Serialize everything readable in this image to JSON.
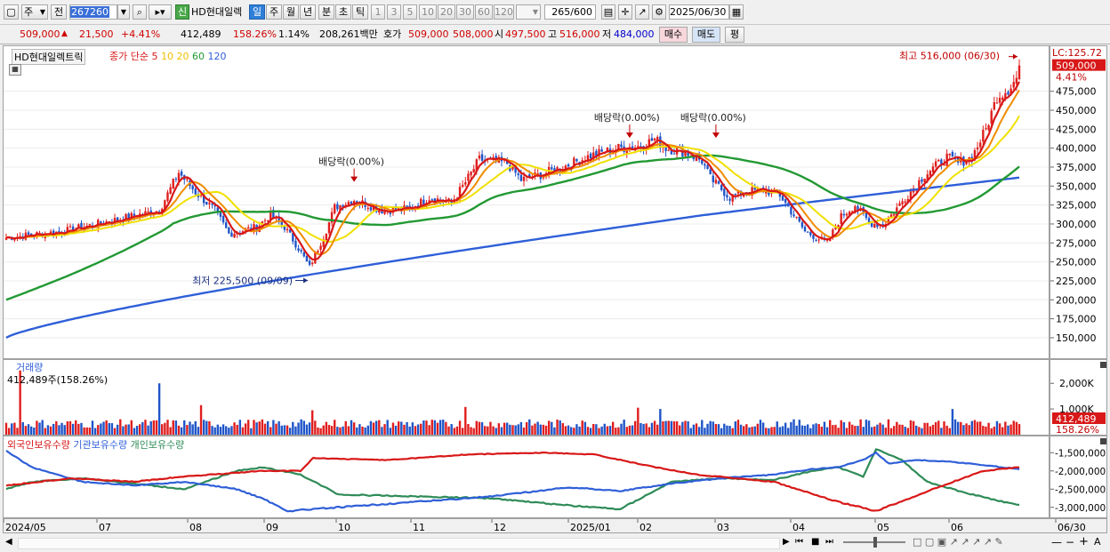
{
  "toolbar": {
    "period_type": "주",
    "prev_label": "전",
    "code": "267260",
    "badge": "신",
    "stock_name": "HD현대일렉",
    "period_buttons": [
      "일",
      "주",
      "월",
      "년",
      "분",
      "초",
      "틱"
    ],
    "active_period": "일",
    "interval_buttons": [
      "1",
      "3",
      "5",
      "10",
      "20",
      "30",
      "60",
      "120"
    ],
    "count_display": "265",
    "count_total": "/600",
    "date": "2025/06/30"
  },
  "quote": {
    "price": "509,000",
    "change": "21,500",
    "change_pct": "+4.41%",
    "volume": "412,489",
    "volume_ratio": "158.26%",
    "turnover": "1.14%",
    "amount": "208,261백만",
    "bid_label": "호가",
    "ask": "509,000",
    "bid": "508,000",
    "open_label": "시",
    "open": "497,500",
    "high_label": "고",
    "high": "516,000",
    "low_label": "저",
    "low": "484,000",
    "buy_label": "매수",
    "sell_label": "매도",
    "close_label": "평"
  },
  "colors": {
    "up": "#e01e1e",
    "down": "#1f55c8",
    "ma5": "#d81818",
    "ma10": "#f08c00",
    "ma20": "#f0e000",
    "ma60": "#229933",
    "ma120": "#2f5fd8",
    "foreign": "#d81818",
    "institution": "#2f5fd8",
    "individual": "#2e8b57"
  },
  "chart_data": [
    {
      "type": "candlestick",
      "title": "HD현대일렉트릭",
      "legend": {
        "prefix": "종가 단순",
        "periods": [
          "5",
          "10",
          "20",
          "60",
          "120"
        ]
      },
      "y_ticks": [
        "150,000",
        "175,000",
        "200,000",
        "225,000",
        "250,000",
        "275,000",
        "300,000",
        "325,000",
        "350,000",
        "375,000",
        "400,000",
        "425,000",
        "450,000",
        "475,000"
      ],
      "ylim": [
        130000,
        525000
      ],
      "lc_label": "LC:125.72",
      "last_price_label": "509,000",
      "last_pct_label": "4.41%",
      "annotations": {
        "high": "최고 516,000 (06/30)",
        "low": "최저 225,500 (09/09)",
        "dividend": "배당락(0.00%)"
      },
      "x_labels": [
        "2024/05",
        "07",
        "08",
        "09",
        "10",
        "11",
        "12",
        "2025/01",
        "02",
        "03",
        "04",
        "05",
        "06",
        "06/30"
      ],
      "close_keypoints": [
        [
          0,
          282000
        ],
        [
          20,
          290000
        ],
        [
          40,
          306000
        ],
        [
          55,
          318000
        ],
        [
          62,
          368000
        ],
        [
          68,
          342000
        ],
        [
          75,
          318000
        ],
        [
          80,
          287000
        ],
        [
          90,
          296000
        ],
        [
          95,
          312000
        ],
        [
          100,
          296000
        ],
        [
          105,
          268000
        ],
        [
          109,
          243000
        ],
        [
          115,
          292000
        ],
        [
          118,
          322000
        ],
        [
          125,
          332000
        ],
        [
          135,
          318000
        ],
        [
          145,
          320000
        ],
        [
          152,
          335000
        ],
        [
          160,
          328000
        ],
        [
          165,
          355000
        ],
        [
          170,
          385000
        ],
        [
          180,
          380000
        ],
        [
          185,
          358000
        ],
        [
          192,
          365000
        ],
        [
          200,
          375000
        ],
        [
          210,
          390000
        ],
        [
          220,
          400000
        ],
        [
          228,
          403000
        ],
        [
          233,
          412000
        ],
        [
          237,
          400000
        ],
        [
          244,
          395000
        ],
        [
          250,
          383000
        ],
        [
          253,
          360000
        ],
        [
          260,
          335000
        ],
        [
          265,
          342000
        ],
        [
          272,
          345000
        ],
        [
          278,
          338000
        ],
        [
          287,
          290000
        ],
        [
          295,
          275000
        ],
        [
          300,
          310000
        ],
        [
          305,
          325000
        ],
        [
          310,
          302000
        ],
        [
          315,
          298000
        ],
        [
          322,
          330000
        ],
        [
          330,
          365000
        ],
        [
          338,
          388000
        ],
        [
          342,
          380000
        ],
        [
          347,
          388000
        ],
        [
          352,
          425000
        ],
        [
          356,
          468000
        ],
        [
          360,
          478000
        ],
        [
          363,
          492000
        ],
        [
          364,
          509000
        ]
      ],
      "ma60_start": 200000,
      "ma120_start": 150000,
      "ma120_end": 368000
    },
    {
      "type": "bar",
      "title": "거래량",
      "value_label": "412,489주(158.26%)",
      "y_ticks": [
        "2,000K",
        "1,000K"
      ],
      "last_label": "412,489",
      "last_pct_label": "158.26%",
      "spikes": [
        [
          5,
          2500000
        ],
        [
          55,
          2000000
        ],
        [
          70,
          1150000
        ],
        [
          110,
          950000
        ],
        [
          165,
          1080000
        ],
        [
          227,
          1050000
        ],
        [
          235,
          1000000
        ],
        [
          340,
          1000000
        ]
      ]
    },
    {
      "type": "line",
      "series_names": [
        "외국인보유수량",
        "기관보유수량",
        "개인보유수량"
      ],
      "y_ticks": [
        "-1,500,000",
        "-2,000,000",
        "-2,500,000",
        "-3,000,000"
      ],
      "ylim": [
        -3250000,
        -1200000
      ],
      "foreign_keypoints": [
        [
          0,
          -2400000
        ],
        [
          25,
          -2200000
        ],
        [
          50,
          -2300000
        ],
        [
          70,
          -2150000
        ],
        [
          100,
          -2000000
        ],
        [
          115,
          -2000000
        ],
        [
          120,
          -1650000
        ],
        [
          150,
          -1700000
        ],
        [
          180,
          -1550000
        ],
        [
          210,
          -1500000
        ],
        [
          230,
          -1550000
        ],
        [
          250,
          -1850000
        ],
        [
          270,
          -2100000
        ],
        [
          300,
          -2300000
        ],
        [
          325,
          -2850000
        ],
        [
          340,
          -3100000
        ],
        [
          355,
          -2700000
        ],
        [
          370,
          -2300000
        ],
        [
          382,
          -2000000
        ],
        [
          396,
          -1900000
        ]
      ],
      "institution_keypoints": [
        [
          0,
          -1450000
        ],
        [
          10,
          -1900000
        ],
        [
          30,
          -2300000
        ],
        [
          50,
          -2400000
        ],
        [
          70,
          -2300000
        ],
        [
          90,
          -2500000
        ],
        [
          100,
          -2750000
        ],
        [
          110,
          -3100000
        ],
        [
          130,
          -3000000
        ],
        [
          160,
          -2850000
        ],
        [
          190,
          -2700000
        ],
        [
          220,
          -2450000
        ],
        [
          240,
          -2550000
        ],
        [
          260,
          -2350000
        ],
        [
          280,
          -2200000
        ],
        [
          300,
          -2100000
        ],
        [
          315,
          -1950000
        ],
        [
          325,
          -1900000
        ],
        [
          335,
          -1700000
        ],
        [
          340,
          -1500000
        ],
        [
          345,
          -1800000
        ],
        [
          355,
          -1700000
        ],
        [
          370,
          -1750000
        ],
        [
          396,
          -1950000
        ]
      ],
      "individual_keypoints": [
        [
          0,
          -2500000
        ],
        [
          10,
          -2300000
        ],
        [
          30,
          -2200000
        ],
        [
          50,
          -2350000
        ],
        [
          70,
          -2500000
        ],
        [
          90,
          -2000000
        ],
        [
          100,
          -1900000
        ],
        [
          115,
          -2100000
        ],
        [
          130,
          -2650000
        ],
        [
          160,
          -2700000
        ],
        [
          190,
          -2750000
        ],
        [
          220,
          -2950000
        ],
        [
          240,
          -3050000
        ],
        [
          260,
          -2300000
        ],
        [
          280,
          -2200000
        ],
        [
          300,
          -2250000
        ],
        [
          315,
          -2000000
        ],
        [
          325,
          -1900000
        ],
        [
          335,
          -2150000
        ],
        [
          340,
          -1400000
        ],
        [
          350,
          -1700000
        ],
        [
          360,
          -2300000
        ],
        [
          375,
          -2600000
        ],
        [
          396,
          -2950000
        ]
      ]
    }
  ]
}
